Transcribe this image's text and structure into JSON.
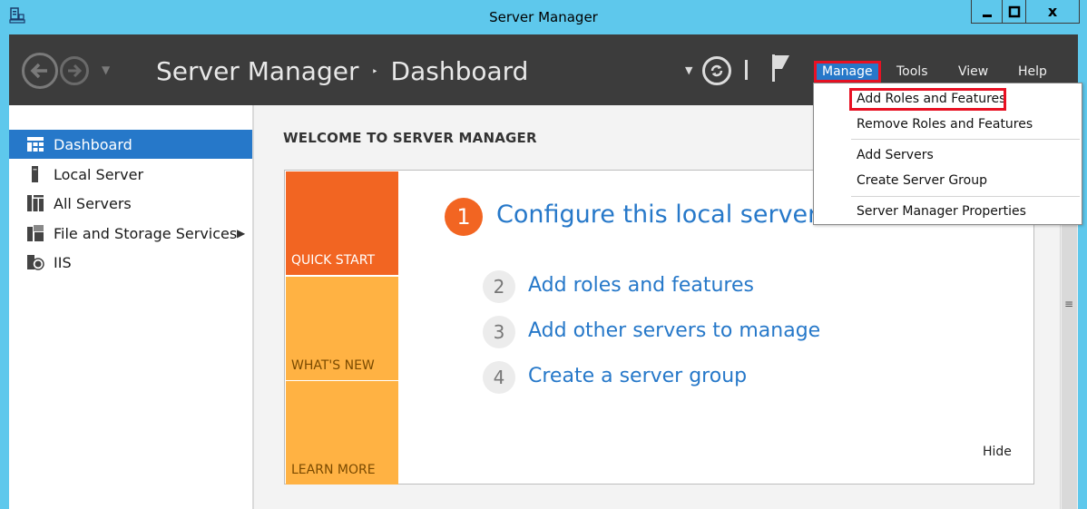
{
  "window": {
    "title": "Server Manager",
    "controls": {
      "minimize": "–",
      "maximize": "□",
      "close": "x"
    }
  },
  "header": {
    "breadcrumb_root": "Server Manager",
    "breadcrumb_separator": "‣",
    "breadcrumb_current": "Dashboard",
    "menu": {
      "manage": "Manage",
      "tools": "Tools",
      "view": "View",
      "help": "Help"
    }
  },
  "sidebar": {
    "items": [
      {
        "label": "Dashboard",
        "icon": "dashboard-icon",
        "active": true
      },
      {
        "label": "Local Server",
        "icon": "server-icon"
      },
      {
        "label": "All Servers",
        "icon": "servers-icon"
      },
      {
        "label": "File and Storage Services",
        "icon": "storage-icon",
        "expand": "▶"
      },
      {
        "label": "IIS",
        "icon": "iis-icon"
      }
    ]
  },
  "main": {
    "welcome": "WELCOME TO SERVER MANAGER",
    "tiles": {
      "quick_start": "QUICK START",
      "whats_new": "WHAT'S NEW",
      "learn_more": "LEARN MORE"
    },
    "steps": [
      {
        "number": "1",
        "label": "Configure this local server"
      },
      {
        "number": "2",
        "label": "Add roles and features"
      },
      {
        "number": "3",
        "label": "Add other servers to manage"
      },
      {
        "number": "4",
        "label": "Create a server group"
      }
    ],
    "hide": "Hide"
  },
  "manage_menu": {
    "items": [
      "Add Roles and Features",
      "Remove Roles and Features",
      "Add Servers",
      "Create Server Group",
      "Server Manager Properties"
    ]
  },
  "colors": {
    "accent": "#2678c9",
    "highlight_border": "#e81123",
    "quick_start": "#f26522",
    "tiles": "#ffb243",
    "frame": "#5ec8ec",
    "header": "#3c3c3c"
  }
}
